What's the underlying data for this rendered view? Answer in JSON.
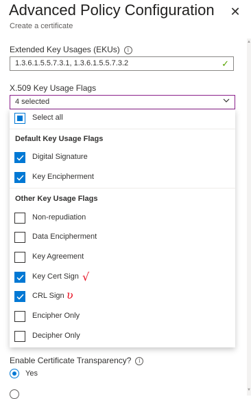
{
  "header": {
    "title": "Advanced Policy Configuration",
    "subtitle": "Create a certificate"
  },
  "ekus": {
    "label": "Extended Key Usages (EKUs)",
    "value": "1.3.6.1.5.5.7.3.1, 1.3.6.1.5.5.7.3.2"
  },
  "key_usage": {
    "label": "X.509 Key Usage Flags",
    "selected_text": "4 selected",
    "select_all_label": "Select all",
    "default_group_label": "Default Key Usage Flags",
    "other_group_label": "Other Key Usage Flags",
    "default_flags": [
      {
        "label": "Digital Signature",
        "checked": true
      },
      {
        "label": "Key Encipherment",
        "checked": true
      }
    ],
    "other_flags": [
      {
        "label": "Non-repudiation",
        "checked": false
      },
      {
        "label": "Data Encipherment",
        "checked": false
      },
      {
        "label": "Key Agreement",
        "checked": false
      },
      {
        "label": "Key Cert Sign",
        "checked": true
      },
      {
        "label": "CRL Sign",
        "checked": true
      },
      {
        "label": "Encipher Only",
        "checked": false
      },
      {
        "label": "Decipher Only",
        "checked": false
      }
    ]
  },
  "transparency": {
    "label": "Enable Certificate Transparency?",
    "option_yes": "Yes"
  },
  "colors": {
    "accent": "#0078d4",
    "annotation": "#e81123",
    "valid": "#57a300"
  }
}
